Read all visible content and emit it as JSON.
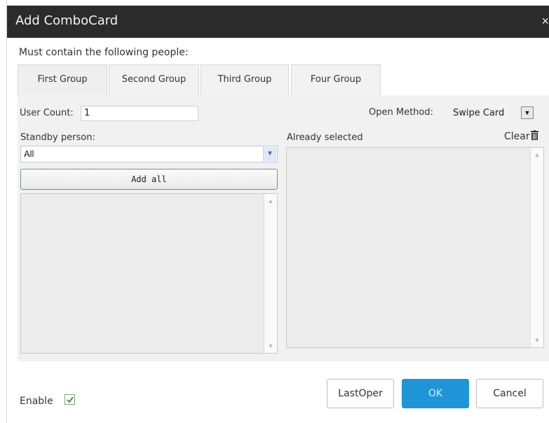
{
  "dialog": {
    "title": "Add ComboCard",
    "close_glyph": "×"
  },
  "heading": "Must contain the following people:",
  "tabs": [
    {
      "label": "First Group"
    },
    {
      "label": "Second Group"
    },
    {
      "label": "Third Group"
    },
    {
      "label": "Four Group"
    }
  ],
  "user_count": {
    "label": "User Count:",
    "value": "1"
  },
  "open_method": {
    "label": "Open Method:",
    "value": "Swipe Card"
  },
  "standby": {
    "label": "Standby person:",
    "select_value": "All",
    "add_all_label": "Add all"
  },
  "selected": {
    "label": "Already selected",
    "clear_label": "Clear"
  },
  "buttons": {
    "last_oper": "LastOper",
    "ok": "OK",
    "cancel": "Cancel"
  },
  "enable": {
    "label": "Enable",
    "checked": true
  },
  "icons": [
    "close-icon",
    "dropdown-arrow-icon",
    "chevron-down-icon",
    "trash-icon",
    "scroll-up-icon",
    "scroll-down-icon",
    "checkmark-icon"
  ],
  "colors": {
    "titlebar": "#2b2b2b",
    "ok_button": "#1e95d7",
    "panel_bg": "#f1f1f1"
  }
}
